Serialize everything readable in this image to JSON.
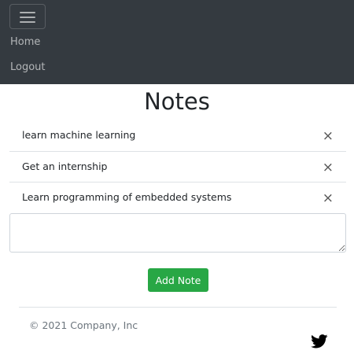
{
  "navbar": {
    "background": "#343a40",
    "toggler_icon": "hamburger-menu-icon",
    "links": [
      {
        "label": "Home"
      },
      {
        "label": "Logout"
      }
    ]
  },
  "main": {
    "title": "Notes",
    "notes": [
      {
        "text": "learn machine learning",
        "delete_icon": "×"
      },
      {
        "text": "Get an internship",
        "delete_icon": "×"
      },
      {
        "text": "Learn programming of embedded systems",
        "delete_icon": "×"
      }
    ],
    "input": {
      "value": "",
      "placeholder": ""
    },
    "add_button": {
      "label": "Add Note",
      "color": "#28a745"
    }
  },
  "footer": {
    "copyright": "© 2021 Company, Inc",
    "social_icon": "twitter-icon"
  }
}
